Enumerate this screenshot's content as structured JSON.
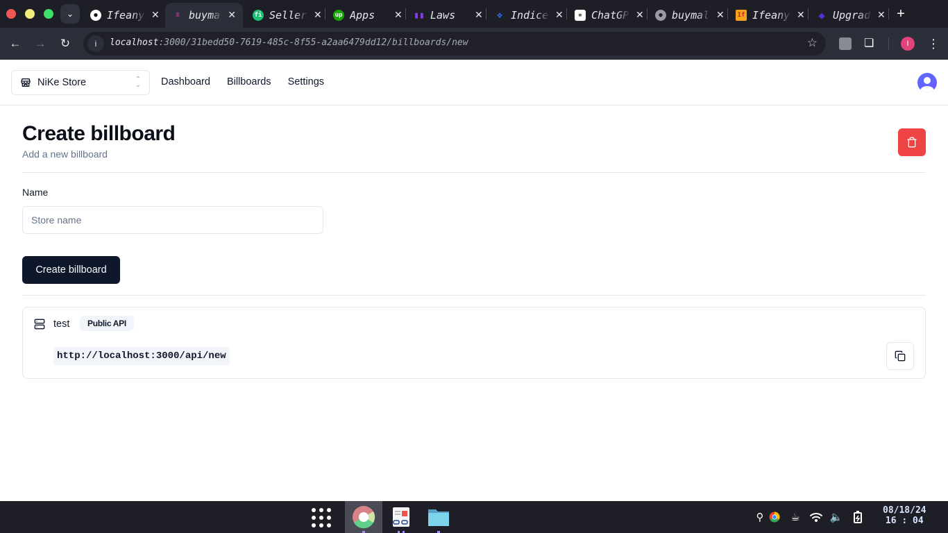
{
  "browser": {
    "tabs": [
      {
        "title": "Ifeanyi",
        "icon": "github-icon",
        "active": false
      },
      {
        "title": "buymall",
        "icon": "buymall-icon",
        "active": true
      },
      {
        "title": "Seller",
        "icon": "fiverr-icon",
        "active": false
      },
      {
        "title": "Apps",
        "icon": "upwork-icon",
        "active": false
      },
      {
        "title": "Laws",
        "icon": "books-icon",
        "active": false
      },
      {
        "title": "Indices",
        "icon": "indices-icon",
        "active": false
      },
      {
        "title": "ChatGPT",
        "icon": "openai-icon",
        "active": false
      },
      {
        "title": "buymall",
        "icon": "globe-icon",
        "active": false
      },
      {
        "title": "Ifeanyi",
        "icon": "portfolio-icon",
        "active": false
      },
      {
        "title": "Upgrade",
        "icon": "diamond-icon",
        "active": false
      }
    ],
    "url_host": "localhost",
    "url_rest": ":3000/31bedd50-7619-485c-8f55-a2aa6479dd12/billboards/new",
    "profile_initial": "I"
  },
  "header": {
    "store_name": "NiKe Store",
    "nav": [
      "Dashboard",
      "Billboards",
      "Settings"
    ]
  },
  "page": {
    "title": "Create billboard",
    "subtitle": "Add a new billboard",
    "form": {
      "name_label": "Name",
      "name_value": "",
      "name_placeholder": "Store name",
      "submit_label": "Create billboard"
    },
    "api_alert": {
      "title": "test",
      "badge": "Public API",
      "url": "http://localhost:3000/api/new"
    }
  },
  "colors": {
    "destructive": "#ef4444",
    "primary": "#0f172a",
    "border": "#e2e8f0"
  },
  "taskbar": {
    "date": "08/18/24",
    "time": "16 : 04"
  }
}
